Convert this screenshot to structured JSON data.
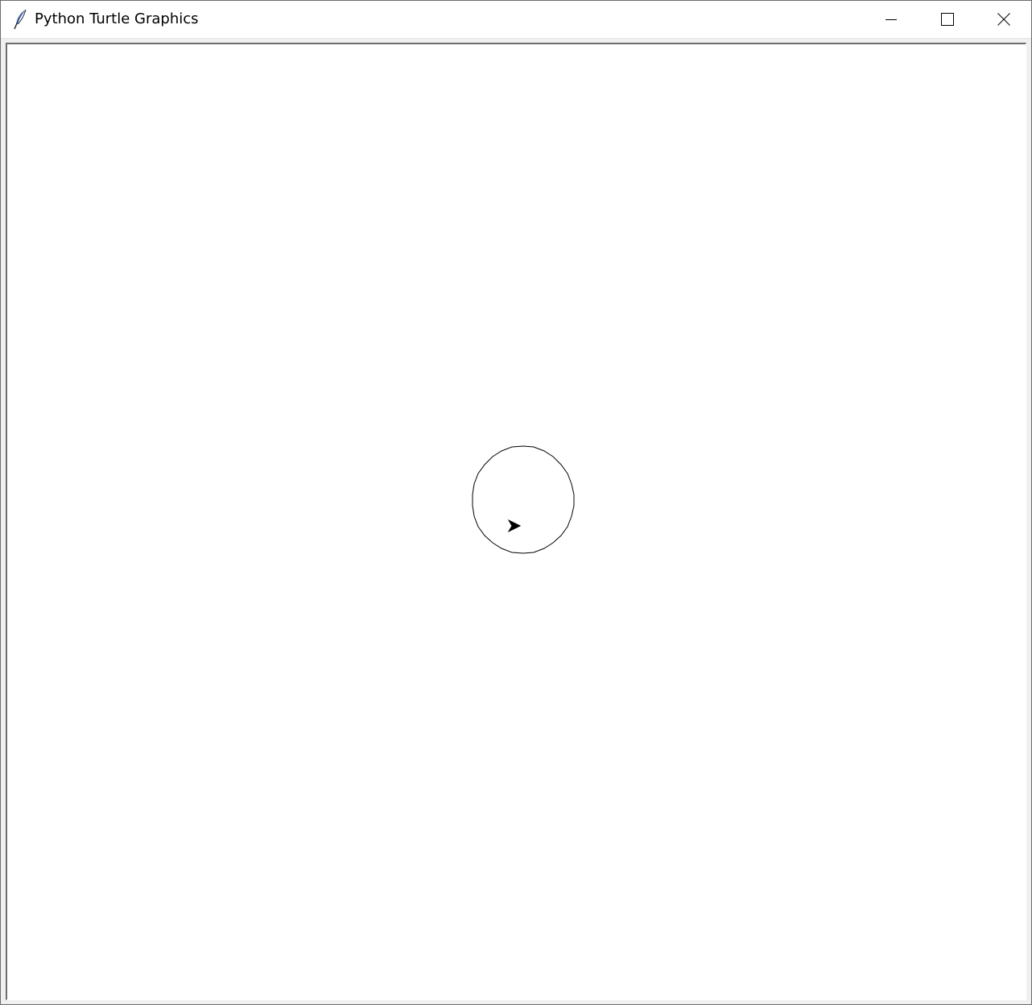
{
  "window": {
    "title": "Python Turtle Graphics",
    "app_icon": "feather-icon",
    "controls": {
      "minimize_icon": "minimize-icon",
      "maximize_icon": "maximize-icon",
      "close_icon": "close-icon"
    }
  },
  "canvas": {
    "background": "#ffffff",
    "drawing": {
      "shape": "circle",
      "stroke_color": "#000000",
      "turtle_cursor": "arrow-icon",
      "turtle_color": "#000000"
    }
  }
}
